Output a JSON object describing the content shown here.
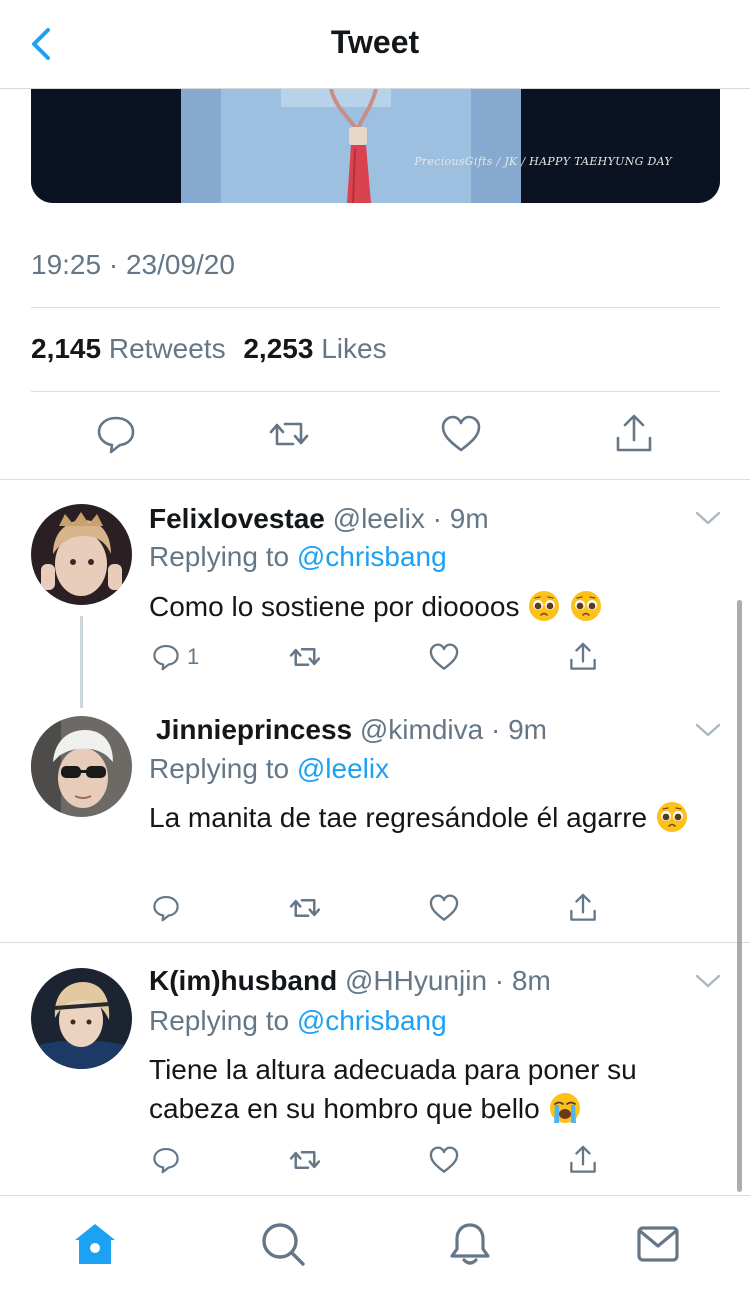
{
  "header": {
    "title": "Tweet"
  },
  "media": {
    "watermark": "PreciousGifts / JK / HAPPY TAEHYUNG DAY"
  },
  "tweet": {
    "timestamp": "19:25 · 23/09/20",
    "retweets": "2,145",
    "retweets_label": "Retweets",
    "likes": "2,253",
    "likes_label": "Likes"
  },
  "replies": [
    {
      "name": "Felixlovestae",
      "meta": " @leelix · 9m",
      "replying_prefix": "Replying to ",
      "mention": "@chrisbang",
      "text": "Como lo sostiene por dioooos",
      "emoji": [
        "pleading-face",
        "pleading-face"
      ],
      "reply_count": "1"
    },
    {
      "name": "Jinnieprincess",
      "meta": "  @kimdiva · 9m",
      "replying_prefix": "Replying to ",
      "mention": "@leelix",
      "text": "La manita de tae regresándole él agarre",
      "emoji": [
        "pleading-face"
      ],
      "reply_count": ""
    },
    {
      "name": "K(im)husband",
      "meta": " @HHyunjin · 8m",
      "replying_prefix": "Replying to ",
      "mention": "@chrisbang",
      "text": "Tiene la altura adecuada para poner su cabeza en su hombro que bello",
      "emoji": [
        "loudly-crying-face"
      ],
      "reply_count": ""
    }
  ],
  "tabbar": {
    "items": [
      "home-icon",
      "search-icon",
      "notifications-icon",
      "messages-icon"
    ],
    "active": "home-icon"
  },
  "colors": {
    "accent": "#1da1f2",
    "secondary_text": "#657786",
    "primary_text": "#14171a"
  }
}
